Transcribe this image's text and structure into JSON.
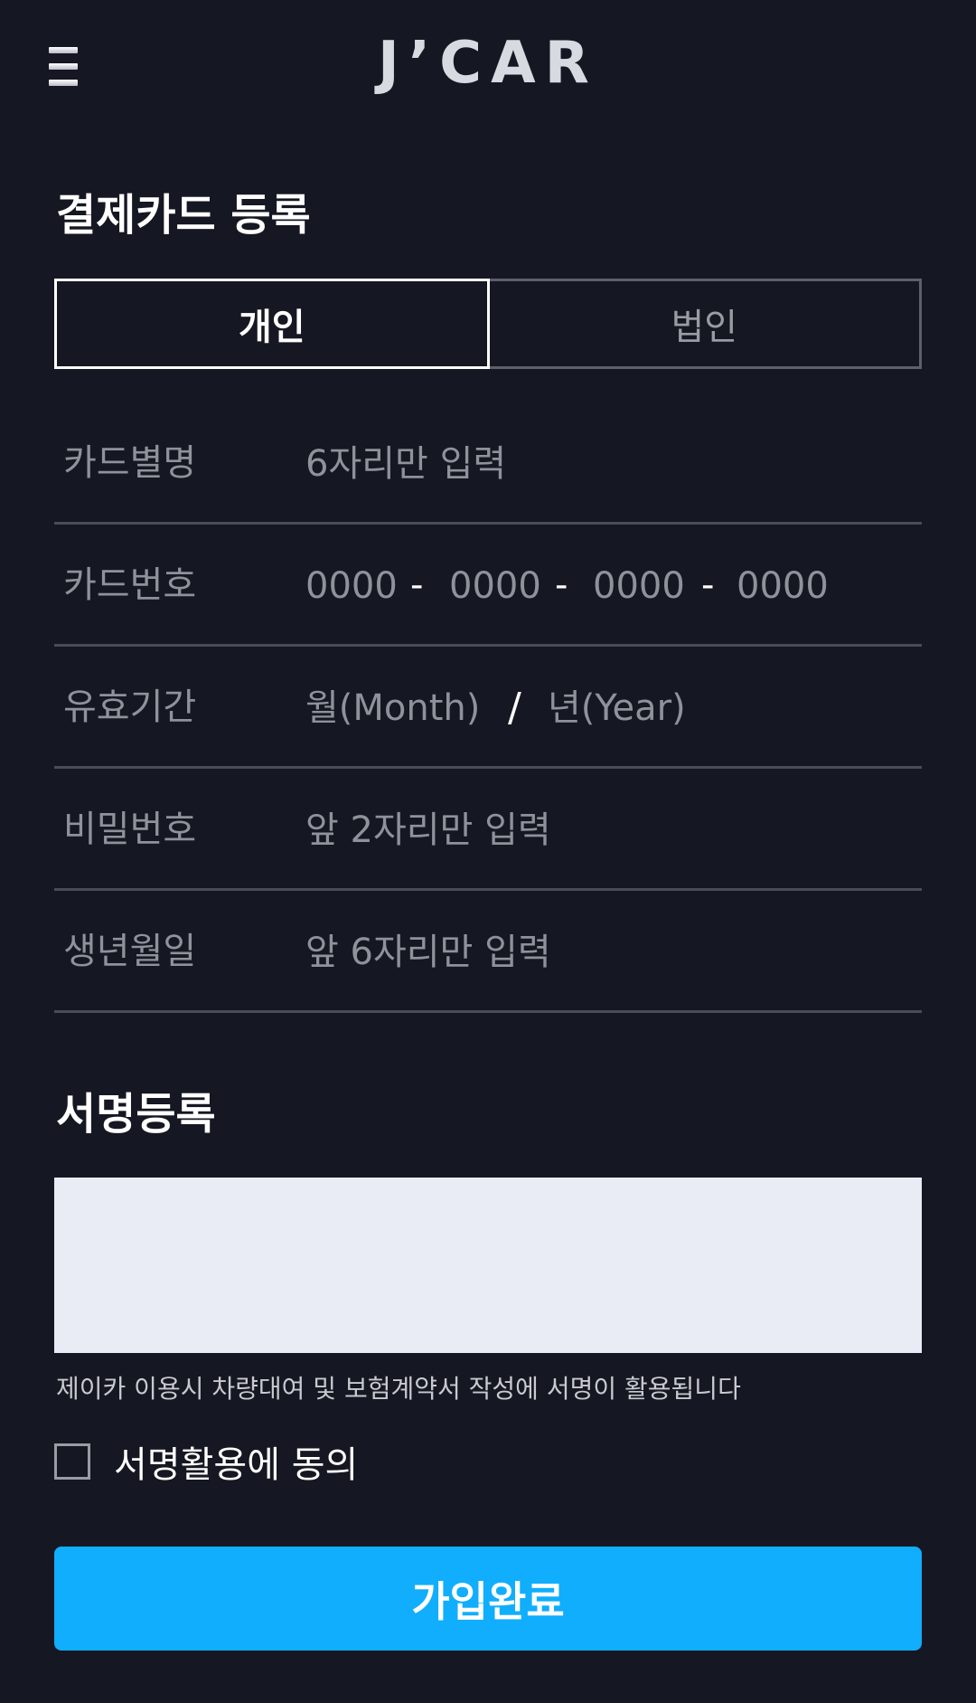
{
  "header": {
    "menu_icon": "hamburger-icon",
    "logo": "J’CAR"
  },
  "card_section": {
    "title": "결제카드 등록",
    "tabs": [
      {
        "label": "개인",
        "active": true
      },
      {
        "label": "법인",
        "active": false
      }
    ],
    "fields": {
      "alias": {
        "label": "카드별명",
        "placeholder": "6자리만 입력",
        "value": ""
      },
      "number": {
        "label": "카드번호",
        "segments": [
          "0000",
          "0000",
          "0000",
          "0000"
        ],
        "separator": "-"
      },
      "expiry": {
        "label": "유효기간",
        "month_placeholder": "월(Month)",
        "separator": "/",
        "year_placeholder": "년(Year)"
      },
      "password": {
        "label": "비밀번호",
        "placeholder": "앞 2자리만 입력",
        "value": ""
      },
      "birth": {
        "label": "생년월일",
        "placeholder": "앞 6자리만 입력",
        "value": ""
      }
    }
  },
  "signature_section": {
    "title": "서명등록",
    "note": "제이카 이용시 차량대여 및 보험계약서 작성에 서명이 활용됩니다",
    "agree_label": "서명활용에 동의",
    "agree_checked": false
  },
  "submit_label": "가입완료",
  "colors": {
    "background": "#151722",
    "accent": "#10aefc",
    "sign_pad": "#e9ecf5"
  }
}
